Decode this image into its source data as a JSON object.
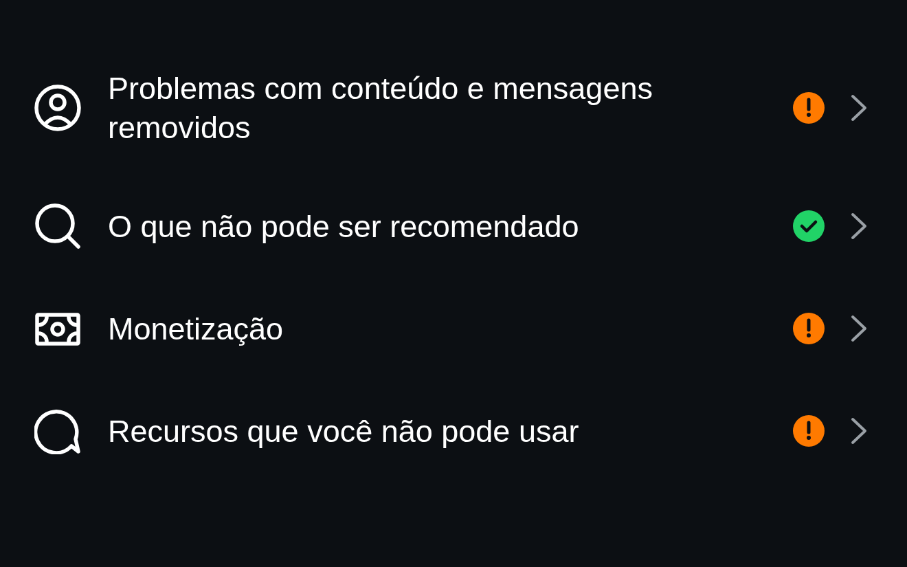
{
  "items": [
    {
      "kind": "account",
      "label": "Problemas com conteúdo e mensagens removidos",
      "badge": {
        "kind": "warning"
      }
    },
    {
      "kind": "search",
      "label": "O que não pode ser recomendado",
      "badge": {
        "kind": "ok"
      }
    },
    {
      "kind": "money",
      "label": "Monetização",
      "badge": {
        "kind": "warning"
      }
    },
    {
      "kind": "chat",
      "label": "Recursos que você não pode usar",
      "badge": {
        "kind": "warning"
      }
    }
  ]
}
